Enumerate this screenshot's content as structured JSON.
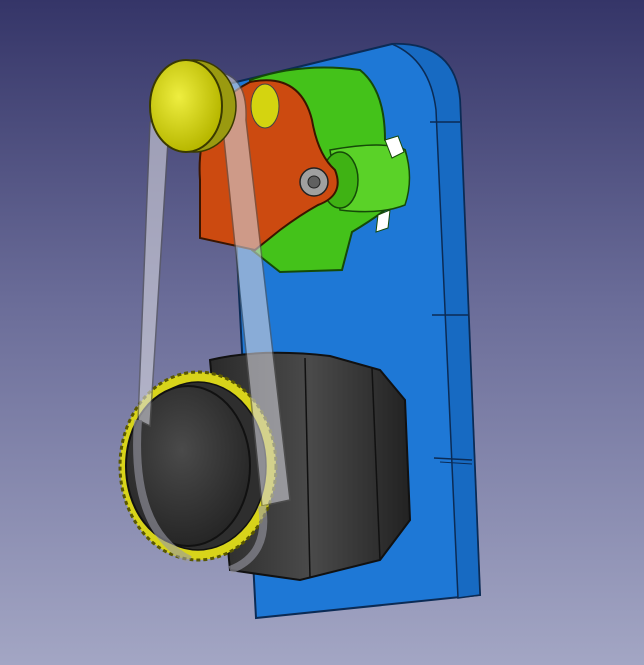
{
  "app": {
    "name": "FreeCAD 3D view"
  },
  "viewport": {
    "background_top": "#353568",
    "background_bottom": "#a3a6c4"
  },
  "model": {
    "parts": [
      {
        "name": "mounting-plate",
        "color": "#1e78d6"
      },
      {
        "name": "motor-housing",
        "color": "#44c21a"
      },
      {
        "name": "motor-flange",
        "color": "#cc4a10"
      },
      {
        "name": "small-pulley-cap",
        "color": "#d4d410"
      },
      {
        "name": "large-pulley",
        "color": "#3a3a3a"
      },
      {
        "name": "pulley-gear-ring",
        "color": "#d8d41a"
      },
      {
        "name": "timing-belt",
        "color": "#c8c8d0"
      }
    ]
  }
}
